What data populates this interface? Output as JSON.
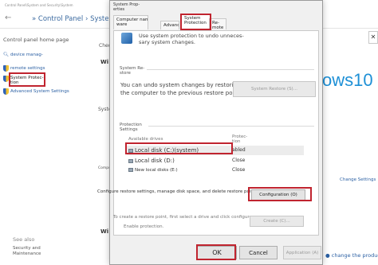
{
  "control_panel": {
    "path_text": "Control Panel\\System and Security\\System",
    "address_text": "» Control Panel › System",
    "home_label": "Control panel home page",
    "links": {
      "device_manager": "device manag-",
      "remote_settings": "remote settings",
      "system_protection": "System Protec-\ntion",
      "advanced": "Advanced System Settings"
    },
    "see_also": "See also",
    "security_maintenance": "Security and Maintenance",
    "windows_logo_text": "ows10",
    "change_settings": "Change Settings",
    "change_key": "change the product",
    "close_glyph": "✕",
    "fragments": {
      "check": "Check",
      "wi1": "Wi",
      "system": "System",
      "compute": "Compute",
      "wi2": "Wi"
    }
  },
  "dialog": {
    "title": "System Prop-\nerties",
    "tabs": {
      "computer_name": "Computer name hard-\nware",
      "advanced": "Advanced",
      "system_protection": "System\nProtection",
      "remote": "Re-\nmote"
    },
    "intro_text": "Use system protection to undo unneces-\nsary system changes.",
    "restore_group": "System Re-\nstore",
    "restore_text": "You can undo system changes by restoring\nthe computer to the previous restore point.",
    "restore_button": "System Restore (S)...",
    "protection_group": "Protection\nSettings",
    "table": {
      "header_drive": "Available drives",
      "header_protection": "Protec-\ntion",
      "rows": [
        {
          "drive": "Local disk (C:)(system)",
          "protection": "abled",
          "selected": true
        },
        {
          "drive": "Local disk (D:)",
          "protection": "Close",
          "selected": false
        },
        {
          "drive": "New local disks (E:)",
          "protection": "Close",
          "selected": false
        }
      ]
    },
    "configure_text": "Configure restore settings, manage disk space, and delete restore points.",
    "configure_button": "Configuration (O)",
    "create_text": "To create a restore point, first select a drive and click configure",
    "create_sub": "Enable protection.",
    "create_button": "Create (C)...",
    "ok_button": "OK",
    "cancel_button": "Cancel",
    "apply_button": "Application (A)"
  },
  "colors": {
    "highlight": "#c0242f",
    "link": "#2a5fa3",
    "windows_blue": "#1e90d6"
  }
}
